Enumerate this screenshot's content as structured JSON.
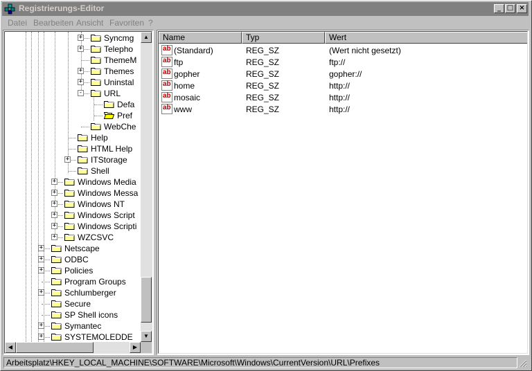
{
  "window": {
    "title": "Registrierungs-Editor",
    "minimize_glyph": "_",
    "maximize_glyph": "□",
    "close_glyph": "×"
  },
  "menu": [
    "Datei",
    "Bearbeiten",
    "Ansicht",
    "Favoriten",
    "?"
  ],
  "tree": [
    {
      "label": "Syncmg",
      "level": 3,
      "expander": "+"
    },
    {
      "label": "Telepho",
      "level": 3,
      "expander": "+"
    },
    {
      "label": "ThemeM",
      "level": 3,
      "expander": ""
    },
    {
      "label": "Themes",
      "level": 3,
      "expander": "+"
    },
    {
      "label": "Uninstal",
      "level": 3,
      "expander": "+"
    },
    {
      "label": "URL",
      "level": 3,
      "expander": "-"
    },
    {
      "label": "Defa",
      "level": 4,
      "expander": ""
    },
    {
      "label": "Pref",
      "level": 4,
      "expander": "",
      "open": true
    },
    {
      "label": "WebChe",
      "level": 3,
      "expander": ""
    },
    {
      "label": "Help",
      "level": 2,
      "expander": ""
    },
    {
      "label": "HTML Help",
      "level": 2,
      "expander": ""
    },
    {
      "label": "ITStorage",
      "level": 2,
      "expander": "+"
    },
    {
      "label": "Shell",
      "level": 2,
      "expander": ""
    },
    {
      "label": "Windows Media",
      "level": 1,
      "expander": "+"
    },
    {
      "label": "Windows Messa",
      "level": 1,
      "expander": "+"
    },
    {
      "label": "Windows NT",
      "level": 1,
      "expander": "+"
    },
    {
      "label": "Windows Script",
      "level": 1,
      "expander": "+"
    },
    {
      "label": "Windows Scripti",
      "level": 1,
      "expander": "+"
    },
    {
      "label": "WZCSVC",
      "level": 1,
      "expander": "+"
    },
    {
      "label": "Netscape",
      "level": 0,
      "expander": "+"
    },
    {
      "label": "ODBC",
      "level": 0,
      "expander": "+"
    },
    {
      "label": "Policies",
      "level": 0,
      "expander": "+"
    },
    {
      "label": "Program Groups",
      "level": 0,
      "expander": ""
    },
    {
      "label": "Schlumberger",
      "level": 0,
      "expander": "+"
    },
    {
      "label": "Secure",
      "level": 0,
      "expander": ""
    },
    {
      "label": "SP Shell icons",
      "level": 0,
      "expander": ""
    },
    {
      "label": "Symantec",
      "level": 0,
      "expander": "+"
    },
    {
      "label": "SYSTEMOLEDDE",
      "level": 0,
      "expander": "+"
    }
  ],
  "list": {
    "columns": [
      "Name",
      "Typ",
      "Wert"
    ],
    "rows": [
      {
        "name": "(Standard)",
        "type": "REG_SZ",
        "value": "(Wert nicht gesetzt)"
      },
      {
        "name": "ftp",
        "type": "REG_SZ",
        "value": "ftp://"
      },
      {
        "name": "gopher",
        "type": "REG_SZ",
        "value": "gopher://"
      },
      {
        "name": "home",
        "type": "REG_SZ",
        "value": "http://"
      },
      {
        "name": "mosaic",
        "type": "REG_SZ",
        "value": "http://"
      },
      {
        "name": "www",
        "type": "REG_SZ",
        "value": "http://"
      }
    ],
    "value_icon_text": "ab"
  },
  "status": {
    "path": "Arbeitsplatz\\HKEY_LOCAL_MACHINE\\SOFTWARE\\Microsoft\\Windows\\CurrentVersion\\URL\\Prefixes"
  },
  "scroll": {
    "up": "▲",
    "down": "▼",
    "left": "◀",
    "right": "▶"
  }
}
